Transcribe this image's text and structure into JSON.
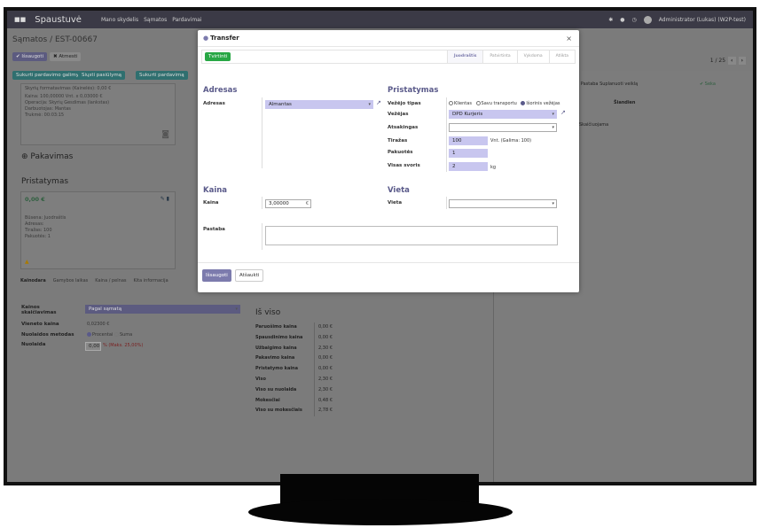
{
  "app": {
    "brand": "Spaustuvė",
    "menu": [
      "Mano skydelis",
      "Sąmatos",
      "Pardavimai"
    ],
    "user": "Administrator (Lukas) (W2P-test)"
  },
  "breadcrumb": "Sąmatos / EST-00667",
  "actions": {
    "save": "✔ Išsaugoti",
    "discard": "✖ Atmesti"
  },
  "action_buttons": [
    "Sukurti pardavimo galimybę",
    "Siųsti pasiūlymą",
    "Sukurti pardavimą"
  ],
  "pager": "1 / 25",
  "left": {
    "card_lines": [
      "Skyrių formatavimas (Kainelės): 0,00 €",
      "Kaina: 100,00000 Vnt. x 0,03000 €",
      "Operacija: Skyrių Gesdimas (lankstas)",
      "Darbuotojas: Mantas",
      "Trukmė: 00:03:15"
    ],
    "packaging_title": "Pakavimas",
    "delivery_title": "Pristatymas",
    "delivery_price": "0,00 €",
    "delivery_lines": [
      "Būsena: Juodraštis",
      "Adresas:",
      "Tiražas: 100",
      "Pakuotės: 1"
    ],
    "tabs": [
      "Kainodara",
      "Gamybos laikas",
      "Kaina / pelnas",
      "Kita informacija"
    ],
    "pricing": {
      "calc_label": "Kainos skaičiavimas",
      "calc_value": "Pagal sąmatą",
      "unit_label": "Vieneto kaina",
      "unit_value": "0,02300 €",
      "disc_type_label": "Nuolaidos metodas",
      "disc_opt1": "Procentai",
      "disc_opt2": "Suma",
      "disc_label": "Nuolaida",
      "disc_value": "0,00",
      "disc_max": "% (Maks. 25,00%)"
    },
    "totals_title": "Iš viso",
    "totals": [
      {
        "label": "Paruošimo kaina",
        "value": "0,00 €"
      },
      {
        "label": "Spausdinimo kaina",
        "value": "0,00 €"
      },
      {
        "label": "Užbaigimo kaina",
        "value": "2,30 €"
      },
      {
        "label": "Pakavimo kaina",
        "value": "0,00 €"
      },
      {
        "label": "Pristatymo kaina",
        "value": "0,00 €"
      },
      {
        "label": "Viso",
        "value": "2,30 €"
      },
      {
        "label": "Viso su nuolaida",
        "value": "2,30 €"
      },
      {
        "label": "Mokesčiai",
        "value": "0,48 €"
      },
      {
        "label": "Viso su mokesčiais",
        "value": "2,78 €"
      }
    ]
  },
  "chatter": {
    "tabs": "Žinutė  Pastaba  Suplanuoti veiklą",
    "follow": "✔ Seka",
    "today": "Šiandien",
    "line1": "Skaičiuojama"
  },
  "modal": {
    "title": "Transfer",
    "close": "×",
    "confirm": "Tvirtinti",
    "steps": [
      "Juodraštis",
      "Patvirtinta",
      "Vykdoma",
      "Atlikta"
    ],
    "address_group": "Adresas",
    "address_label": "Adresas",
    "address_value": "Almantas",
    "delivery_group": "Pristatymas",
    "carrier_type_label": "Vežėjo tipas",
    "carrier_types": [
      "Klientas",
      "Savu transportu",
      "Išorinis vežėjas"
    ],
    "carrier_label": "Vežėjas",
    "carrier_value": "DPD Kurjeris",
    "responsible_label": "Atsakingas",
    "qty_label": "Tiražas",
    "qty_value": "100",
    "qty_note": "Vnt. (Galima: 100)",
    "pkg_label": "Pakuotės",
    "pkg_value": "1",
    "weight_label": "Visas svoris",
    "weight_value": "2",
    "weight_unit": "kg",
    "price_group": "Kaina",
    "price_label": "Kaina",
    "price_value": "3,00000",
    "price_currency": "€",
    "place_group": "Vieta",
    "place_label": "Vieta",
    "note_label": "Pastaba",
    "save": "Išsaugoti",
    "cancel": "Atšaukti"
  }
}
